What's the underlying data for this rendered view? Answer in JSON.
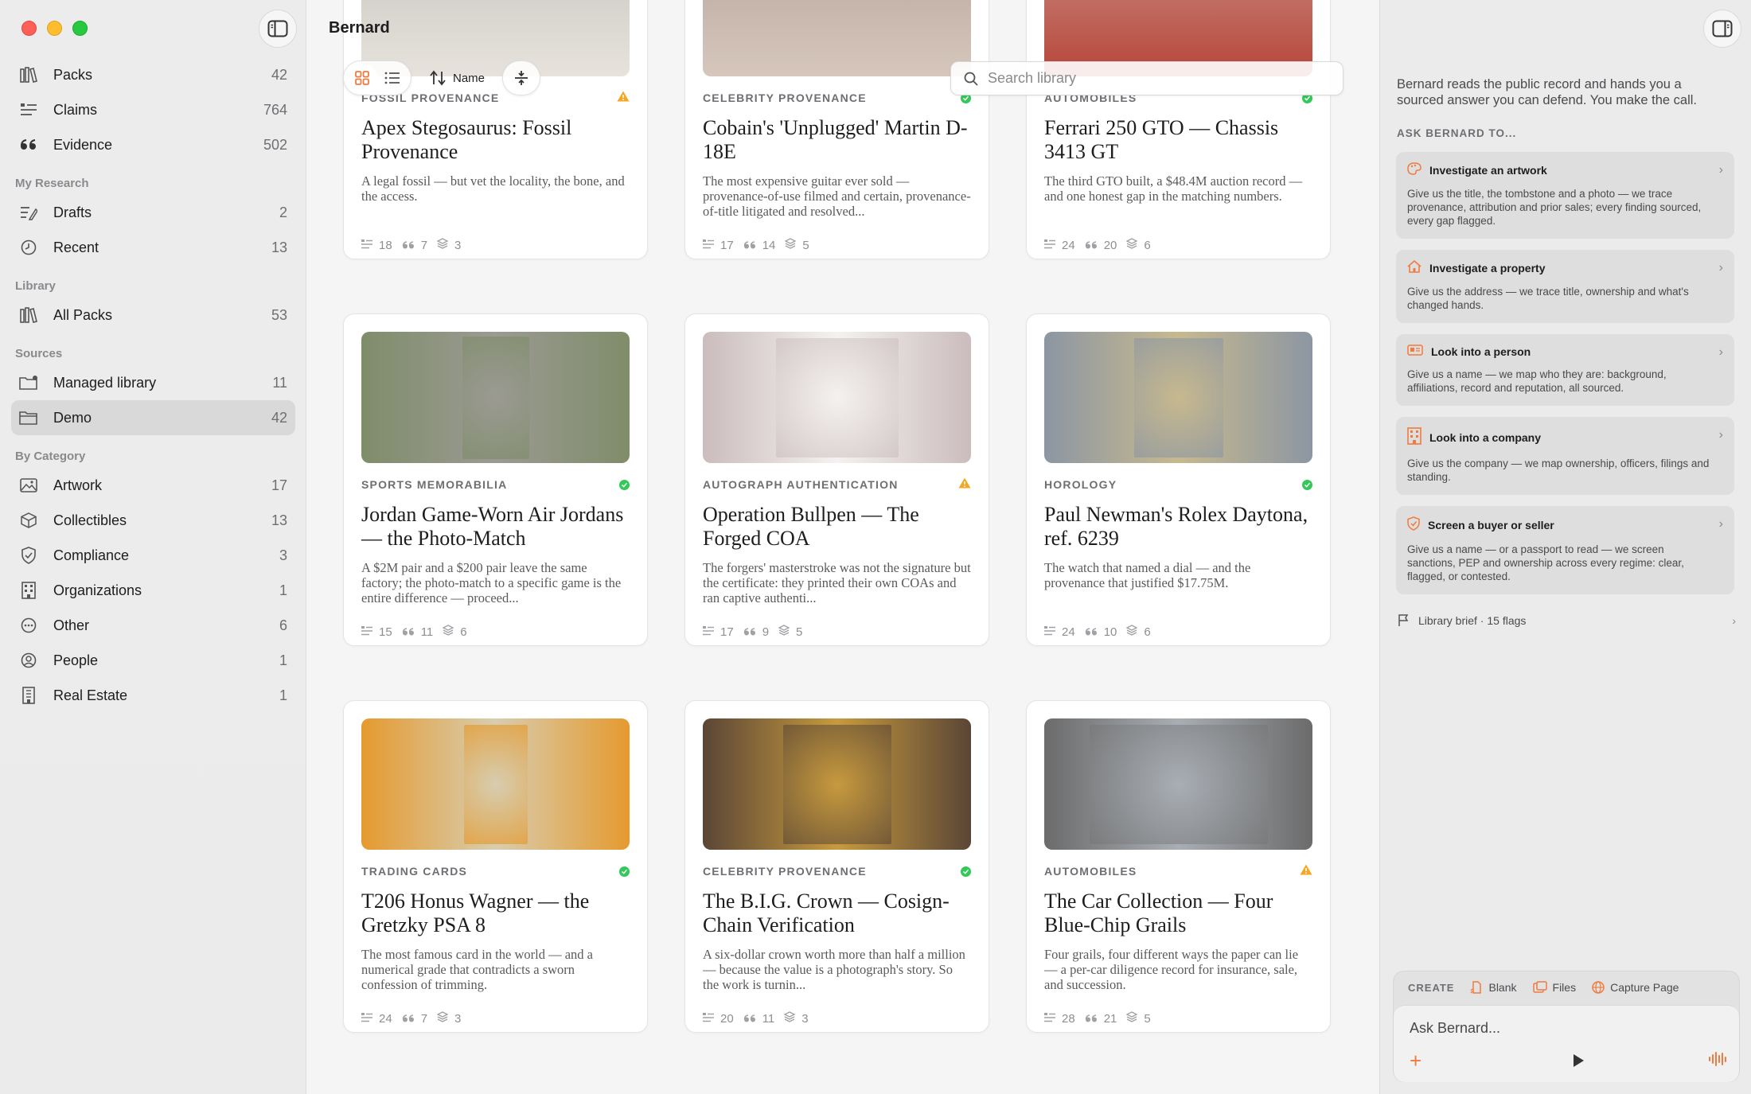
{
  "colors": {
    "accent": "#f07b3f",
    "status_ok": "#34c759",
    "status_warn": "#f5a623"
  },
  "sidebar": {
    "top_items": [
      {
        "label": "Packs",
        "count": "42",
        "icon": "packs-icon"
      },
      {
        "label": "Claims",
        "count": "764",
        "icon": "claims-icon"
      },
      {
        "label": "Evidence",
        "count": "502",
        "icon": "quote-icon"
      }
    ],
    "sections": [
      {
        "title": "My Research",
        "items": [
          {
            "label": "Drafts",
            "count": "2",
            "icon": "drafts-icon"
          },
          {
            "label": "Recent",
            "count": "13",
            "icon": "clock-icon"
          }
        ]
      },
      {
        "title": "Library",
        "items": [
          {
            "label": "All Packs",
            "count": "53",
            "icon": "library-icon"
          }
        ]
      },
      {
        "title": "Sources",
        "items": [
          {
            "label": "Managed library",
            "count": "11",
            "icon": "folder-badge-icon"
          },
          {
            "label": "Demo",
            "count": "42",
            "icon": "folder-icon",
            "active": true
          }
        ]
      },
      {
        "title": "By Category",
        "items": [
          {
            "label": "Artwork",
            "count": "17",
            "icon": "photo-icon"
          },
          {
            "label": "Collectibles",
            "count": "13",
            "icon": "cube-icon"
          },
          {
            "label": "Compliance",
            "count": "3",
            "icon": "shield-check-icon"
          },
          {
            "label": "Organizations",
            "count": "1",
            "icon": "building-icon"
          },
          {
            "label": "Other",
            "count": "6",
            "icon": "ellipsis-circle-icon"
          },
          {
            "label": "People",
            "count": "1",
            "icon": "person-circle-icon"
          },
          {
            "label": "Real Estate",
            "count": "1",
            "icon": "tower-icon"
          }
        ]
      }
    ]
  },
  "main": {
    "title": "Bernard",
    "sort_label": "Name",
    "search_placeholder": "Search library",
    "cards": [
      {
        "category": "Fossil Provenance",
        "status": "warn",
        "title": "Apex Stegosaurus: Fossil Provenance",
        "desc": "A legal fossil — but vet the locality, the bone, and the access.",
        "claims": "18",
        "evidence": "7",
        "sources": "3",
        "bg": "#c9c7c2",
        "thumb": "#e7e3dc"
      },
      {
        "category": "Celebrity Provenance",
        "status": "ok",
        "title": "Cobain's 'Unplugged' Martin D-18E",
        "desc": "The most expensive guitar ever sold — provenance-of-use filmed and certain, provenance-of-title litigated and resolved...",
        "claims": "17",
        "evidence": "14",
        "sources": "5",
        "bg": "#b9a79c",
        "thumb": "#d6c7bd"
      },
      {
        "category": "Automobiles",
        "status": "ok",
        "title": "Ferrari 250 GTO — Chassis 3413 GT",
        "desc": "The third GTO built, a $48.4M auction record — and one honest gap in the matching numbers.",
        "claims": "24",
        "evidence": "20",
        "sources": "6",
        "bg": "#c98a7e",
        "thumb": "#b7453a"
      },
      {
        "category": "Sports Memorabilia",
        "status": "ok",
        "title": "Jordan Game-Worn Air Jordans — the Photo-Match",
        "desc": "A $2M pair and a $200 pair leave the same factory; the photo-match to a specific game is the entire difference — proceed...",
        "claims": "15",
        "evidence": "11",
        "sources": "6",
        "bg": "#7f8d6a",
        "thumb": "#9b9a93"
      },
      {
        "category": "Autograph Authentication",
        "status": "warn",
        "title": "Operation Bullpen — The Forged COA",
        "desc": "The forgers' masterstroke was not the signature but the certificate: they printed their own COAs and ran captive authenti...",
        "claims": "17",
        "evidence": "9",
        "sources": "5",
        "bg": "#cbbcbd",
        "thumb": "#f4f2f0"
      },
      {
        "category": "Horology",
        "status": "ok",
        "title": "Paul Newman's Rolex Daytona, ref. 6239",
        "desc": "The watch that named a dial — and the provenance that justified $17.75M.",
        "claims": "24",
        "evidence": "10",
        "sources": "6",
        "bg": "#8c96a3",
        "thumb": "#c7b98e"
      },
      {
        "category": "Trading Cards",
        "status": "ok",
        "title": "T206 Honus Wagner — the Gretzky PSA 8",
        "desc": "The most famous card in the world — and a numerical grade that contradicts a sworn confession of trimming.",
        "claims": "24",
        "evidence": "7",
        "sources": "3",
        "bg": "#e59a2f",
        "thumb": "#d7cdb0"
      },
      {
        "category": "Celebrity Provenance",
        "status": "ok",
        "title": "The B.I.G. Crown — Cosign-Chain Verification",
        "desc": "A six-dollar crown worth more than half a million — because the value is a photograph's story. So the work is turnin...",
        "claims": "20",
        "evidence": "11",
        "sources": "3",
        "bg": "#5a4636",
        "thumb": "#c79a3e"
      },
      {
        "category": "Automobiles",
        "status": "warn",
        "title": "The Car Collection — Four Blue-Chip Grails",
        "desc": "Four grails, four different ways the paper can lie — a per-car diligence record for insurance, sale, and succession.",
        "claims": "28",
        "evidence": "21",
        "sources": "5",
        "bg": "#6b6b6b",
        "thumb": "#a9aeb4"
      }
    ]
  },
  "panel": {
    "intro": "Bernard reads the public record and hands you a sourced answer you can defend. You make the call.",
    "heading": "ASK BERNARD TO...",
    "actions": [
      {
        "title": "Investigate an artwork",
        "desc": "Give us the title, the tombstone and a photo — we trace provenance, attribution and prior sales; every finding sourced, every gap flagged.",
        "icon": "palette-icon"
      },
      {
        "title": "Investigate a property",
        "desc": "Give us the address — we trace title, ownership and what's changed hands.",
        "icon": "house-icon"
      },
      {
        "title": "Look into a person",
        "desc": "Give us a name — we map who they are: background, affiliations, record and reputation, all sourced.",
        "icon": "id-card-icon"
      },
      {
        "title": "Look into a company",
        "desc": "Give us the company — we map ownership, officers, filings and standing.",
        "icon": "building-icon"
      },
      {
        "title": "Screen a buyer or seller",
        "desc": "Give us a name — or a passport to read — we screen sanctions, PEP and ownership across every regime: clear, flagged, or contested.",
        "icon": "shield-icon"
      }
    ],
    "brief": "Library brief · 15 flags",
    "create_label": "CREATE",
    "create_blank": "Blank",
    "create_files": "Files",
    "create_capture": "Capture Page",
    "ask_placeholder": "Ask Bernard..."
  }
}
